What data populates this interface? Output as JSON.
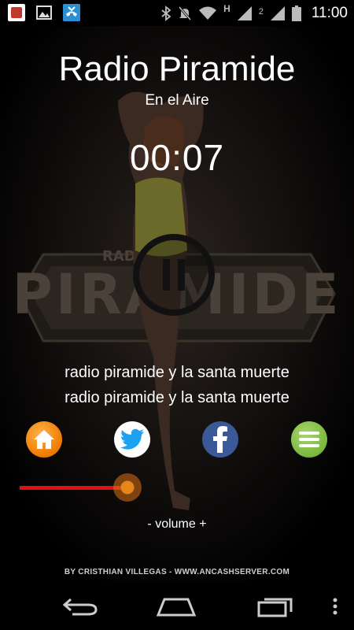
{
  "status_bar": {
    "time": "11:00",
    "sim_label": "2",
    "network_label": "H",
    "notification_icons": [
      "app-notification-icon",
      "gallery-icon",
      "missed-call-icon"
    ],
    "system_icons": [
      "bluetooth-icon",
      "mute-icon",
      "wifi-icon",
      "signal-icon",
      "signal-2-icon",
      "battery-icon"
    ]
  },
  "player": {
    "title": "Radio Piramide",
    "status": "En el Aire",
    "elapsed": "00:07",
    "toggle_icon": "pause-icon",
    "track_line_1": "radio piramide y la santa muerte",
    "track_line_2": "radio piramide y la santa muerte"
  },
  "actions": [
    {
      "name": "home",
      "icon": "home-icon",
      "color": "#f08a12"
    },
    {
      "name": "twitter",
      "icon": "twitter-icon",
      "color": "#1da1f2"
    },
    {
      "name": "facebook",
      "icon": "facebook-icon",
      "color": "#3b5998"
    },
    {
      "name": "menu",
      "icon": "menu-icon",
      "color": "#7ab93f"
    }
  ],
  "volume": {
    "label": "- volume +",
    "level": 0.36,
    "fill_color": "#e01010",
    "knob_color": "#e6851a"
  },
  "footer": {
    "credit": "BY CRISTHIAN VILLEGAS - WWW.ANCASHSERVER.COM"
  },
  "nav": {
    "buttons": [
      "back-icon",
      "home-outline-icon",
      "recent-apps-icon",
      "overflow-menu-icon"
    ]
  }
}
